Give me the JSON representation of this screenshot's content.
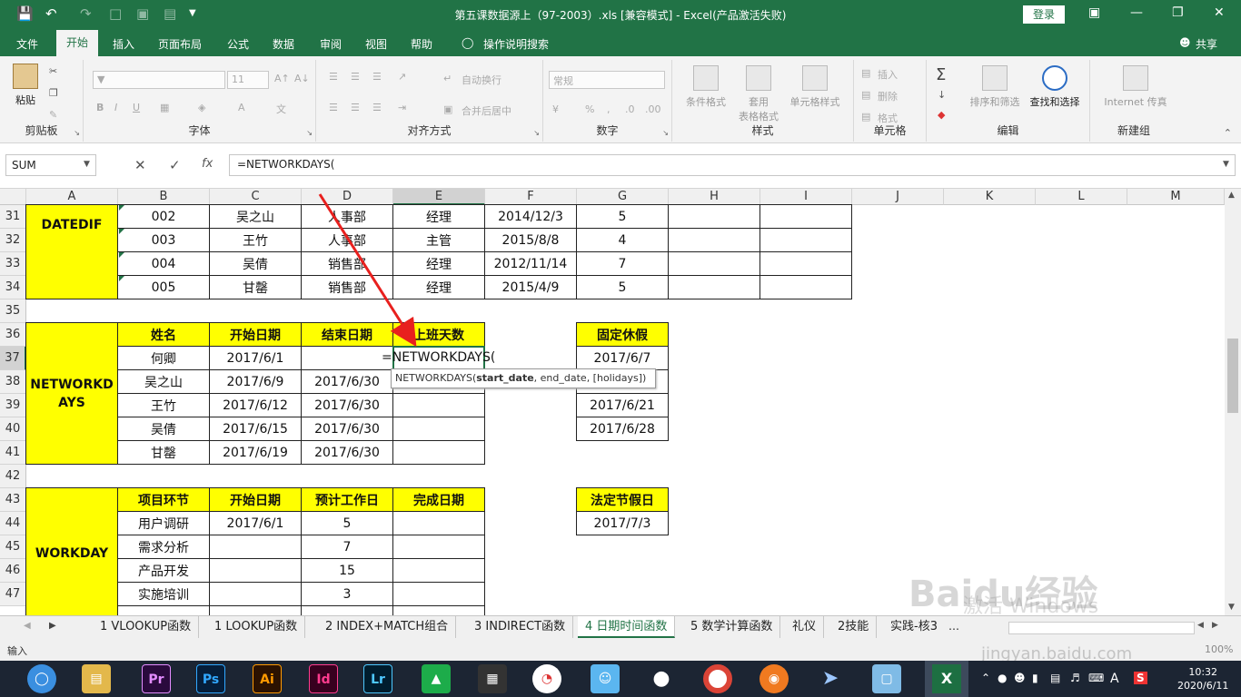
{
  "window": {
    "title": "第五课数据源上（97-2003）.xls  [兼容模式]  -  Excel(产品激活失败)",
    "login": "登录"
  },
  "ribbon_tabs": [
    "文件",
    "开始",
    "插入",
    "页面布局",
    "公式",
    "数据",
    "审阅",
    "视图",
    "帮助",
    "操作说明搜索"
  ],
  "share": "共享",
  "ribbon": {
    "paste": "粘贴",
    "clipboard": "剪贴板",
    "font_size": "11",
    "font_group": "字体",
    "wrap": "自动换行",
    "merge": "合并后居中",
    "align_group": "对齐方式",
    "num_format": "常规",
    "number_group": "数字",
    "cond_fmt": "条件格式",
    "table_fmt1": "套用",
    "table_fmt2": "表格格式",
    "cell_style": "单元格样式",
    "style_group": "样式",
    "insert": "插入",
    "delete": "删除",
    "format": "格式",
    "cells_group": "单元格",
    "sort": "排序和筛选",
    "find": "查找和选择",
    "edit_group": "编辑",
    "internet": "Internet 传真",
    "new_group": "新建组"
  },
  "formula_bar": {
    "namebox": "SUM",
    "fx": "fx",
    "formula": "=NETWORKDAYS("
  },
  "columns": [
    "A",
    "B",
    "C",
    "D",
    "E",
    "F",
    "G",
    "H",
    "I",
    "J",
    "K",
    "L",
    "M"
  ],
  "rows": [
    "31",
    "32",
    "33",
    "34",
    "35",
    "36",
    "37",
    "38",
    "39",
    "40",
    "41",
    "42",
    "43",
    "44",
    "45",
    "46",
    "47"
  ],
  "cells": {
    "datedif": "DATEDIF",
    "networkdays": "NETWORKDAYS",
    "workday": "WORKDAY",
    "r31": [
      "002",
      "吴之山",
      "人事部",
      "经理",
      "2014/12/3",
      "5"
    ],
    "r32": [
      "003",
      "王竹",
      "人事部",
      "主管",
      "2015/8/8",
      "4"
    ],
    "r33": [
      "004",
      "吴倩",
      "销售部",
      "经理",
      "2012/11/14",
      "7"
    ],
    "r34": [
      "005",
      "甘罄",
      "销售部",
      "经理",
      "2015/4/9",
      "5"
    ],
    "h36": [
      "姓名",
      "开始日期",
      "结束日期",
      "上班天数"
    ],
    "fixed_holiday": "固定休假",
    "r37": [
      "何卿",
      "2017/6/1"
    ],
    "editing": "=NETWORKDAYS(",
    "r38": [
      "吴之山",
      "2017/6/9",
      "2017/6/30"
    ],
    "r39": [
      "王竹",
      "2017/6/12",
      "2017/6/30"
    ],
    "r40": [
      "吴倩",
      "2017/6/15",
      "2017/6/30"
    ],
    "r41": [
      "甘罄",
      "2017/6/19",
      "2017/6/30"
    ],
    "holidays": [
      "2017/6/7",
      "2017/6/21",
      "2017/6/28"
    ],
    "h43": [
      "项目环节",
      "开始日期",
      "预计工作日",
      "完成日期"
    ],
    "legal_holiday": "法定节假日",
    "legal_date": "2017/7/3",
    "r44": [
      "用户调研",
      "2017/6/1",
      "5"
    ],
    "r45": [
      "需求分析",
      "7"
    ],
    "r46": [
      "产品开发",
      "15"
    ],
    "r47": [
      "实施培训",
      "3"
    ]
  },
  "tooltip": {
    "fn": "NETWORKDAYS(",
    "arg1": "start_date",
    ", rest": ", end_date, [holidays])",
    "rest": ", end_date, [holidays])"
  },
  "sheets": [
    "1 VLOOKUP函数",
    "1 LOOKUP函数",
    "2 INDEX+MATCH组合",
    "3 INDIRECT函数",
    "4 日期时间函数",
    "5 数学计算函数",
    "礼仪",
    "2技能",
    "实践-核3"
  ],
  "status": {
    "mode": "输入",
    "zoom": "100%"
  },
  "watermark": {
    "line1": "Baidu经验",
    "line2": "激活 Windows",
    "line3": "jingyan.baidu.com"
  },
  "taskbar": {
    "apps": [
      "Pr",
      "Ps",
      "Ai",
      "Id",
      "Lr"
    ],
    "time": "10:32",
    "date": "2020/6/11",
    "ime": "A"
  },
  "colors": {
    "excel_green": "#217346",
    "highlight": "#ffff00",
    "arrow": "#e8201e"
  }
}
